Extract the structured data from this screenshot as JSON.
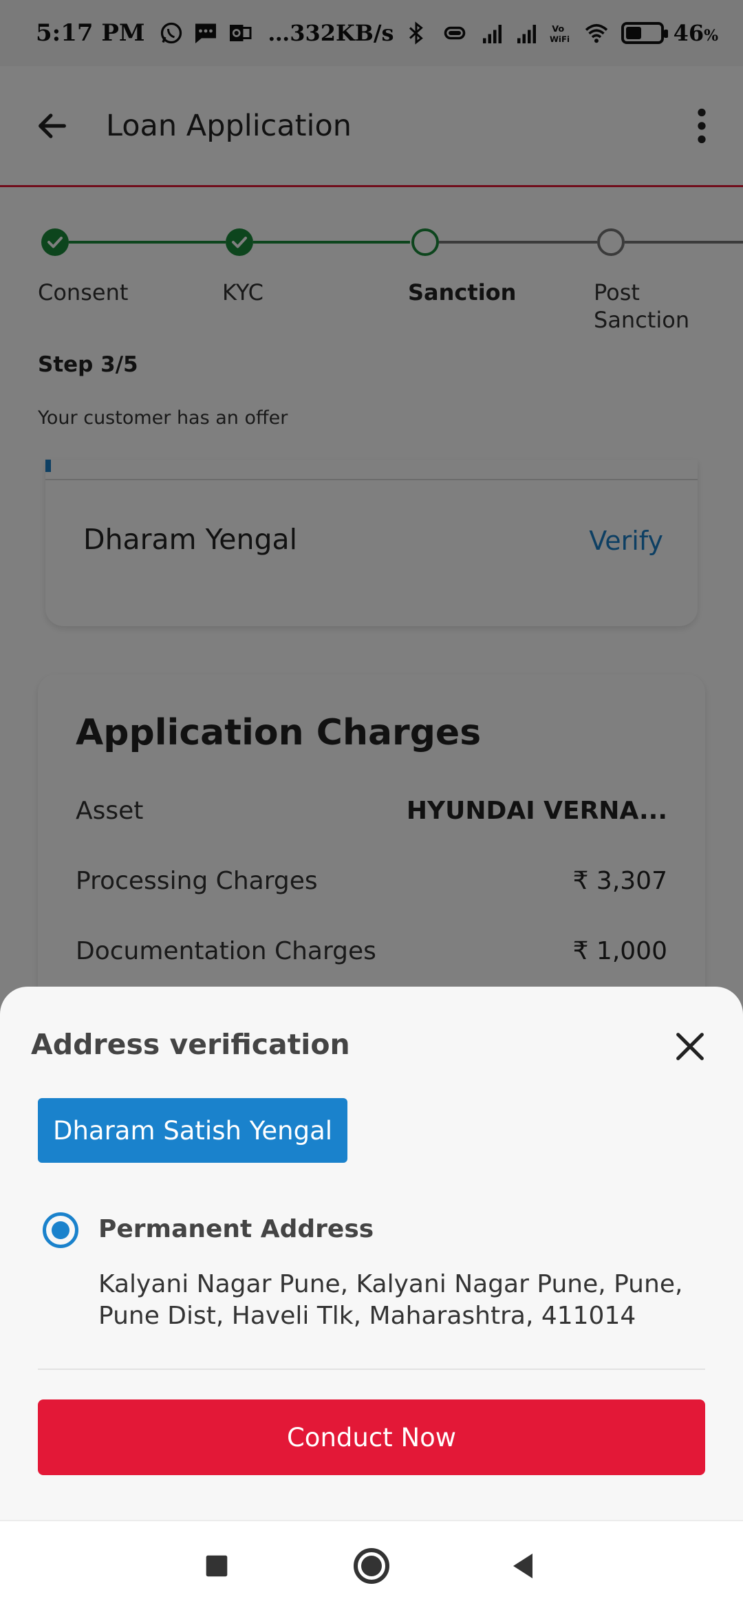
{
  "status_bar": {
    "time": "5:17 PM",
    "network_speed": "…332KB/s",
    "battery_level": 0.46,
    "battery_text": "46",
    "battery_unit": "%",
    "vowifi_label": "Vo WiFi",
    "icons": [
      "whatsapp-icon",
      "message-icon",
      "outlook-icon",
      "bluetooth-icon",
      "vibrate-icon",
      "signal-icon",
      "signal-icon",
      "vowifi-icon",
      "wifi-icon",
      "battery-icon"
    ]
  },
  "app_bar": {
    "title": "Loan Application",
    "back_icon": "arrow-left-icon",
    "more_icon": "more-vertical-icon",
    "accent_color": "#e31837"
  },
  "stepper": {
    "steps": [
      {
        "label": "Consent",
        "status": "done"
      },
      {
        "label": "KYC",
        "status": "done"
      },
      {
        "label": "Sanction",
        "status": "current"
      },
      {
        "label": "Post Sanction",
        "status": "pending"
      }
    ],
    "done_color": "#1a8a3a",
    "pending_color": "#888888",
    "step_count": "Step 3/5",
    "offer_text": "Your customer has an offer"
  },
  "offer_card": {
    "name": "Dharam Yengal",
    "verify_label": "Verify"
  },
  "charges": {
    "title": "Application Charges",
    "rows": [
      {
        "label": "Asset",
        "value": "HYUNDAI VERNA..."
      },
      {
        "label": "Processing Charges",
        "value": "₹ 3,307"
      },
      {
        "label": "Documentation Charges",
        "value": "₹ 1,000"
      }
    ]
  },
  "sheet": {
    "title": "Address verification",
    "close_icon": "close-icon",
    "applicant_name": "Dharam Satish Yengal",
    "address_type": "Permanent Address",
    "address_text": "Kalyani Nagar Pune, Kalyani Nagar Pune, Pune, Pune Dist, Haveli Tlk, Maharashtra, 411014",
    "conduct_label": "Conduct Now",
    "primary_color": "#1a82cc",
    "cta_color": "#e31837"
  },
  "nav_bar": {
    "icons": [
      "recents-icon",
      "home-icon",
      "back-icon"
    ]
  }
}
